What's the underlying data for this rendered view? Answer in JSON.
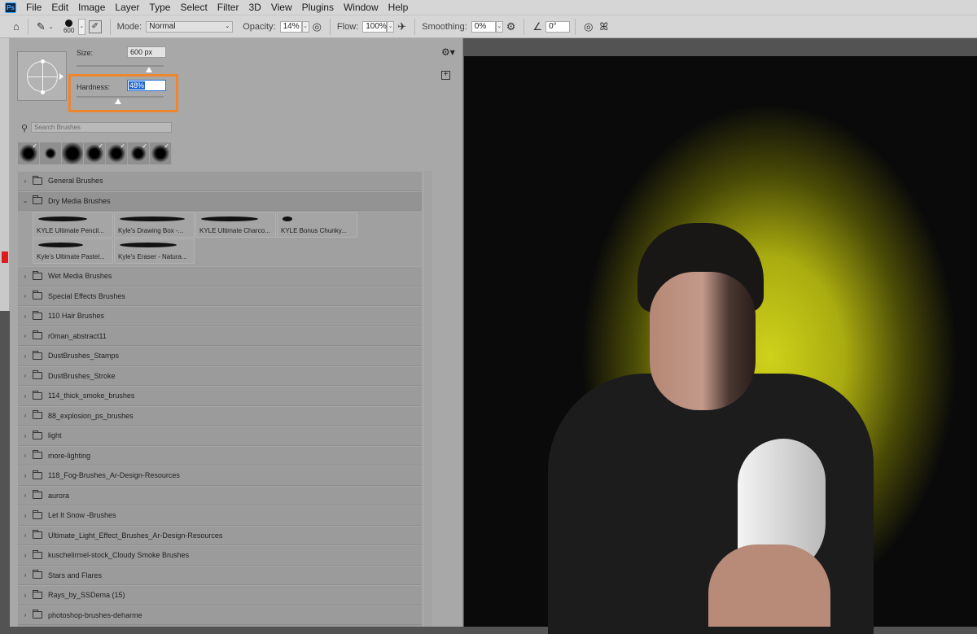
{
  "menubar": {
    "logo": "Ps",
    "items": [
      "File",
      "Edit",
      "Image",
      "Layer",
      "Type",
      "Select",
      "Filter",
      "3D",
      "View",
      "Plugins",
      "Window",
      "Help"
    ]
  },
  "options_bar": {
    "brush_size": "600",
    "mode_label": "Mode:",
    "mode_value": "Normal",
    "opacity_label": "Opacity:",
    "opacity_value": "14%",
    "flow_label": "Flow:",
    "flow_value": "100%",
    "smoothing_label": "Smoothing:",
    "smoothing_value": "0%",
    "angle_value": "0°"
  },
  "brush_panel": {
    "size_label": "Size:",
    "size_value": "600 px",
    "size_fraction": 0.83,
    "hardness_label": "Hardness:",
    "hardness_value": "48%",
    "hardness_fraction": 0.48,
    "search_placeholder": "Search Brushes",
    "recent_brush_count": 7,
    "groups_before": [
      "General Brushes"
    ],
    "open_group": "Dry Media Brushes",
    "dry_media_items": [
      "KYLE Ultimate Pencil...",
      "Kyle's Drawing Box -...",
      "KYLE Ultimate Charco...",
      "KYLE Bonus Chunky...",
      "Kyle's Ultimate Pastel...",
      "Kyle's Eraser - Natura..."
    ],
    "groups_after": [
      "Wet Media Brushes",
      "Special Effects Brushes",
      "110 Hair Brushes",
      "r0man_abstract11",
      "DustBrushes_Stamps",
      "DustBrushes_Stroke",
      "114_thick_smoke_brushes",
      "88_explosion_ps_brushes",
      "light",
      "more-lighting",
      "118_Fog-Brushes_Ar-Design-Resources",
      "aurora",
      "Let It Snow -Brushes",
      "Ultimate_Light_Effect_Brushes_Ar-Design-Resources",
      "kuschelirmel-stock_Cloudy Smoke Brushes",
      "Stars and Flares",
      "Rays_by_SSDema (15)",
      "photoshop-brushes-deharme"
    ]
  },
  "colors": {
    "highlight": "#f0862b",
    "spotlight": "#cfd21a",
    "selection": "#2468d1"
  }
}
